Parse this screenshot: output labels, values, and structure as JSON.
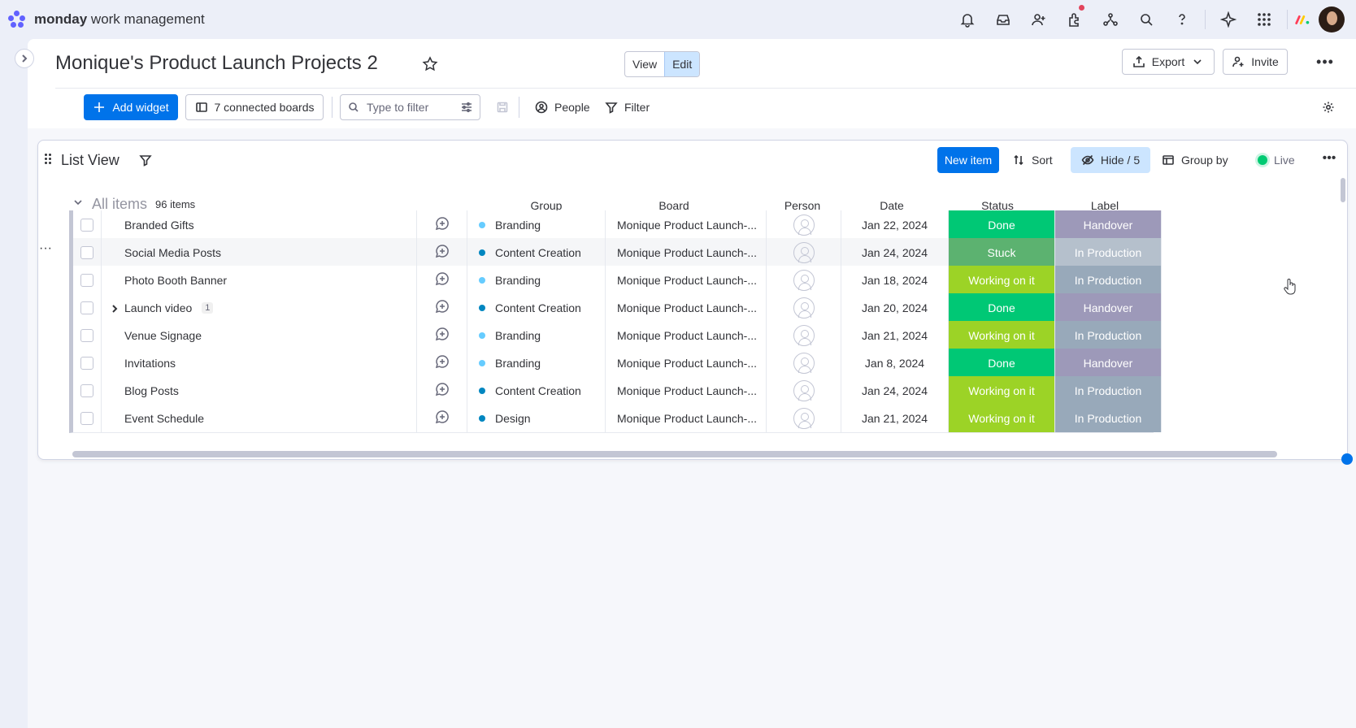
{
  "app": {
    "brand_bold": "monday",
    "brand_rest": " work management"
  },
  "topbar": {
    "icons": [
      "bell-icon",
      "inbox-icon",
      "invite-members-icon",
      "apps-icon",
      "integrations-icon",
      "search-icon",
      "help-icon",
      "ai-icon",
      "grid-icon"
    ],
    "notification_color": "#e2445c"
  },
  "dashboard": {
    "title": "Monique's Product Launch Projects 2",
    "view_label": "View",
    "edit_label": "Edit",
    "export_label": "Export",
    "invite_label": "Invite"
  },
  "toolbar": {
    "add_widget": "Add widget",
    "connected_boards": "7 connected boards",
    "search_placeholder": "Type to filter",
    "people": "People",
    "filter": "Filter"
  },
  "widget": {
    "title": "List View",
    "new_item": "New item",
    "sort": "Sort",
    "hide": "Hide / 5",
    "group_by": "Group by",
    "live": "Live",
    "all_items": "All items",
    "item_count": "96 items",
    "columns": {
      "group": "Group",
      "board": "Board",
      "person": "Person",
      "date": "Date",
      "status": "Status",
      "label": "Label"
    },
    "colors": {
      "primary": "#0073ea",
      "done": "#00c875",
      "working": "#9cd326",
      "stuck": "#5cb270",
      "handover": "#9d99b9",
      "in_production": "#98a9ba",
      "branding_dot": "#66ccff",
      "content_dot": "#0086c0"
    },
    "rows": [
      {
        "name": "Branded Gifts",
        "subitems": "",
        "group": "Branding",
        "group_color": "#66ccff",
        "board": "Monique Product Launch-...",
        "date": "Jan 22, 2024",
        "status": "Done",
        "status_color": "#00c875",
        "label": "Handover",
        "label_color": "#9d99b9"
      },
      {
        "name": "Social Media Posts",
        "subitems": "",
        "group": "Content Creation",
        "group_color": "#0086c0",
        "board": "Monique Product Launch-...",
        "date": "Jan 24, 2024",
        "status": "Stuck",
        "status_color": "#5cb270",
        "label": "In Production",
        "label_color": "#b5c0cc"
      },
      {
        "name": "Photo Booth Banner",
        "subitems": "",
        "group": "Branding",
        "group_color": "#66ccff",
        "board": "Monique Product Launch-...",
        "date": "Jan 18, 2024",
        "status": "Working on it",
        "status_color": "#9cd326",
        "label": "In Production",
        "label_color": "#98a9ba"
      },
      {
        "name": "Launch video",
        "subitems": "1",
        "group": "Content Creation",
        "group_color": "#0086c0",
        "board": "Monique Product Launch-...",
        "date": "Jan 20, 2024",
        "status": "Done",
        "status_color": "#00c875",
        "label": "Handover",
        "label_color": "#9d99b9"
      },
      {
        "name": "Venue Signage",
        "subitems": "",
        "group": "Branding",
        "group_color": "#66ccff",
        "board": "Monique Product Launch-...",
        "date": "Jan 21, 2024",
        "status": "Working on it",
        "status_color": "#9cd326",
        "label": "In Production",
        "label_color": "#98a9ba"
      },
      {
        "name": "Invitations",
        "subitems": "",
        "group": "Branding",
        "group_color": "#66ccff",
        "board": "Monique Product Launch-...",
        "date": "Jan 8, 2024",
        "status": "Done",
        "status_color": "#00c875",
        "label": "Handover",
        "label_color": "#9d99b9"
      },
      {
        "name": "Blog Posts",
        "subitems": "",
        "group": "Content Creation",
        "group_color": "#0086c0",
        "board": "Monique Product Launch-...",
        "date": "Jan 24, 2024",
        "status": "Working on it",
        "status_color": "#9cd326",
        "label": "In Production",
        "label_color": "#98a9ba"
      },
      {
        "name": "Event Schedule",
        "subitems": "",
        "group": "Design",
        "group_color": "#0086c0",
        "board": "Monique Product Launch-...",
        "date": "Jan 21, 2024",
        "status": "Working on it",
        "status_color": "#9cd326",
        "label": "In Production",
        "label_color": "#98a9ba"
      }
    ]
  }
}
